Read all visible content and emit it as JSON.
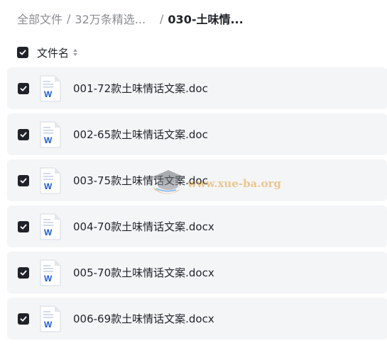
{
  "breadcrumb": {
    "root": "全部文件",
    "parent": "32万条精选...",
    "current": "030-土味情...",
    "separator": "/"
  },
  "list_header": {
    "column_label": "文件名",
    "select_all_checked": true
  },
  "files": [
    {
      "name": "001-72款土味情话文案.doc",
      "checked": true,
      "icon": "word-doc-icon"
    },
    {
      "name": "002-65款土味情话文案.doc",
      "checked": true,
      "icon": "word-doc-icon"
    },
    {
      "name": "003-75款土味情话文案.doc",
      "checked": true,
      "icon": "word-doc-icon"
    },
    {
      "name": "004-70款土味情话文案.docx",
      "checked": true,
      "icon": "word-doc-icon"
    },
    {
      "name": "005-70款土味情话文案.docx",
      "checked": true,
      "icon": "word-doc-icon"
    },
    {
      "name": "006-69款土味情话文案.docx",
      "checked": true,
      "icon": "word-doc-icon"
    }
  ],
  "watermark": {
    "text": "www.xue-ba.org"
  },
  "colors": {
    "checkbox": "#1f2329",
    "row_background": "#f4f5f7",
    "word_blue": "#1e5bd6",
    "breadcrumb_muted": "#8a8d93"
  }
}
